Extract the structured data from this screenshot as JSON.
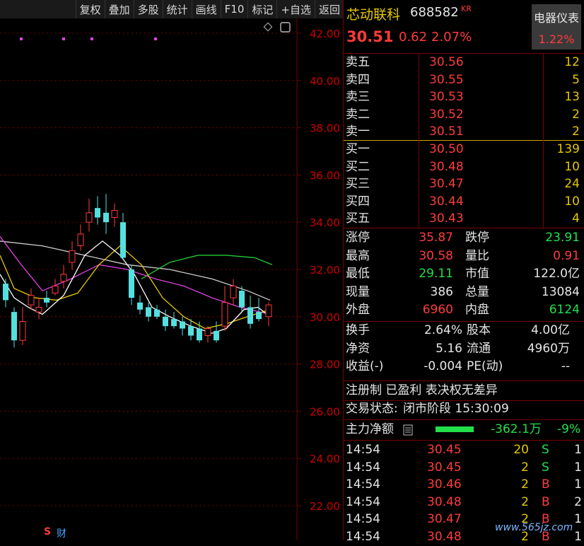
{
  "toolbar": [
    "复权",
    "叠加",
    "多股",
    "统计",
    "画线",
    "F10",
    "标记",
    "+自选",
    "返回"
  ],
  "chart": {
    "price_ticks": [
      "42.00",
      "40.00",
      "38.00",
      "36.00",
      "34.00",
      "32.00",
      "30.00",
      "28.00",
      "26.00",
      "24.00",
      "22.00"
    ],
    "footer_s": "S",
    "footer_cai": "财"
  },
  "header": {
    "name": "芯动联科",
    "code": "688582",
    "tag": "KR",
    "price": "30.51",
    "change": "0.62",
    "change_pct": "2.07%",
    "sector_name": "电器仪表",
    "sector_pct": "1.22%"
  },
  "asks": [
    {
      "label": "卖五",
      "price": "30.56",
      "vol": "12"
    },
    {
      "label": "卖四",
      "price": "30.55",
      "vol": "5"
    },
    {
      "label": "卖三",
      "price": "30.53",
      "vol": "13"
    },
    {
      "label": "卖二",
      "price": "30.52",
      "vol": "2"
    },
    {
      "label": "卖一",
      "price": "30.51",
      "vol": "2"
    }
  ],
  "bids": [
    {
      "label": "买一",
      "price": "30.50",
      "vol": "139"
    },
    {
      "label": "买二",
      "price": "30.48",
      "vol": "10"
    },
    {
      "label": "买三",
      "price": "30.47",
      "vol": "24"
    },
    {
      "label": "买四",
      "price": "30.44",
      "vol": "10"
    },
    {
      "label": "买五",
      "price": "30.43",
      "vol": "4"
    }
  ],
  "stats1": [
    {
      "l1": "涨停",
      "v1": "35.87",
      "l2": "跌停",
      "v2": "23.91"
    },
    {
      "l1": "最高",
      "v1": "30.58",
      "l2": "量比",
      "v2": "0.91"
    },
    {
      "l1": "最低",
      "v1": "29.11",
      "l2": "市值",
      "v2": "122.0亿"
    },
    {
      "l1": "现量",
      "v1": "386",
      "l2": "总量",
      "v2": "13084"
    },
    {
      "l1": "外盘",
      "v1": "6960",
      "l2": "内盘",
      "v2": "6124"
    }
  ],
  "stats2": [
    {
      "l1": "换手",
      "v1": "2.64%",
      "l2": "股本",
      "v2": "4.00亿"
    },
    {
      "l1": "净资",
      "v1": "5.16",
      "l2": "流通",
      "v2": "4960万"
    },
    {
      "l1": "收益(-)",
      "v1": "-0.004",
      "l2": "PE(动)",
      "v2": "--"
    }
  ],
  "info": {
    "reg_line": "注册制 已盈利 表决权无差异",
    "status_label": "交易状态:",
    "status_value": "闭市阶段 15:30:09",
    "net_label": "主力净额",
    "net_value": "-362.1万",
    "net_pct": "-9%"
  },
  "ticks": [
    {
      "time": "14:54",
      "price": "30.45",
      "vol": "20",
      "side": "S",
      "n": "1"
    },
    {
      "time": "14:54",
      "price": "30.45",
      "vol": "2",
      "side": "S",
      "n": "1"
    },
    {
      "time": "14:54",
      "price": "30.46",
      "vol": "2",
      "side": "B",
      "n": "1"
    },
    {
      "time": "14:54",
      "price": "30.48",
      "vol": "2",
      "side": "B",
      "n": "2"
    },
    {
      "time": "14:54",
      "price": "30.47",
      "vol": "2",
      "side": "B",
      "n": "1"
    },
    {
      "time": "14:54",
      "price": "30.48",
      "vol": "2",
      "side": "B",
      "n": "1"
    }
  ],
  "watermark": "www.565jz.com"
}
